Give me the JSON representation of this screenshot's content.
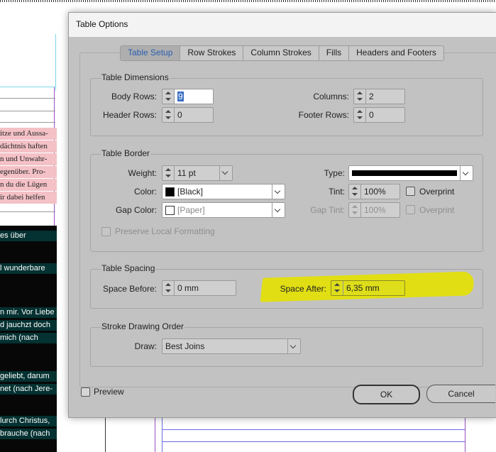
{
  "background_document": {
    "pink_lines": [
      "itze und Aussa-",
      "dächtnis haften",
      "n und Unwahr-",
      "egenüber. Pro-",
      "n du die Lügen",
      "ir dabei helfen"
    ],
    "dark_lines": [
      "es über",
      "l wunderbare",
      "n mir. Vor Liebe",
      "d jauchzt doch",
      "mich (nach",
      "geliebt, darum",
      "net (nach Jere-",
      "lurch Christus,",
      "brauche (nach"
    ]
  },
  "dialog": {
    "title": "Table Options",
    "tabs": [
      {
        "label": "Table Setup",
        "active": true
      },
      {
        "label": "Row Strokes"
      },
      {
        "label": "Column Strokes"
      },
      {
        "label": "Fills"
      },
      {
        "label": "Headers and Footers"
      }
    ],
    "table_dimensions": {
      "legend": "Table Dimensions",
      "body_rows_label": "Body Rows:",
      "body_rows": "9",
      "header_rows_label": "Header Rows:",
      "header_rows": "0",
      "columns_label": "Columns:",
      "columns": "2",
      "footer_rows_label": "Footer Rows:",
      "footer_rows": "0"
    },
    "table_border": {
      "legend": "Table Border",
      "weight_label": "Weight:",
      "weight": "11 pt",
      "type_label": "Type:",
      "color_label": "Color:",
      "color": "[Black]",
      "tint_label": "Tint:",
      "tint": "100%",
      "overprint_label": "Overprint",
      "gap_color_label": "Gap Color:",
      "gap_color": "[Paper]",
      "gap_tint_label": "Gap Tint:",
      "gap_tint": "100%",
      "gap_overprint_label": "Overprint",
      "preserve_label": "Preserve Local Formatting"
    },
    "table_spacing": {
      "legend": "Table Spacing",
      "space_before_label": "Space Before:",
      "space_before": "0 mm",
      "space_after_label": "Space After:",
      "space_after": "6,35 mm"
    },
    "stroke_drawing_order": {
      "legend": "Stroke Drawing Order",
      "draw_label": "Draw:",
      "draw": "Best Joins"
    },
    "preview_label": "Preview",
    "ok_label": "OK",
    "cancel_label": "Cancel"
  },
  "colors": {
    "dialog_bg": "#c2c2c2",
    "highlight": "#e1df14",
    "active_tab_text": "#2a5fb0",
    "pink_text_bg": "#f3c1c6"
  }
}
